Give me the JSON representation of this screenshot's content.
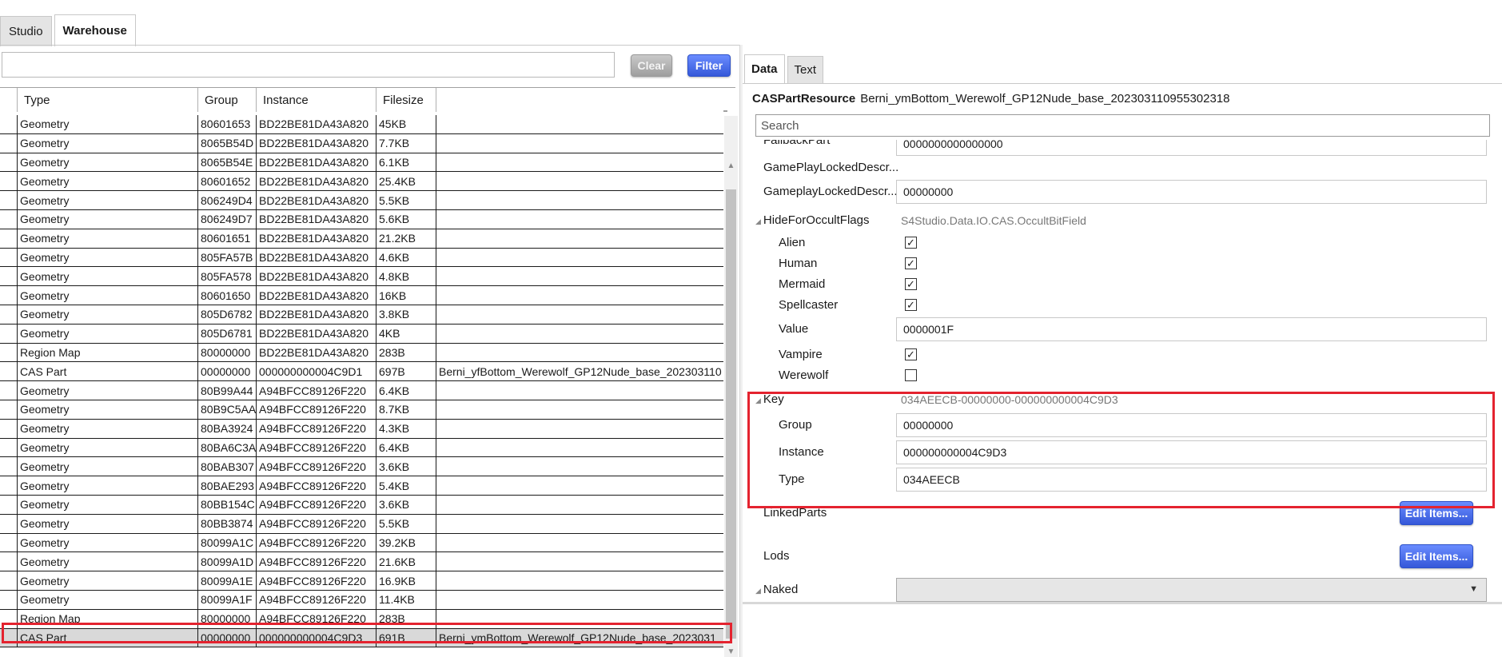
{
  "top_tabs": [
    {
      "label": "Studio",
      "active": false
    },
    {
      "label": "Warehouse",
      "active": true
    }
  ],
  "filter": {
    "value": "",
    "clear_label": "Clear",
    "filter_label": "Filter"
  },
  "grid": {
    "columns": [
      "",
      "Type",
      "Group",
      "Instance",
      "Filesize",
      ""
    ],
    "rows": [
      {
        "type": "Geometry",
        "group": "80601653",
        "instance": "BD22BE81DA43A820",
        "filesize": "45KB",
        "name": ""
      },
      {
        "type": "Geometry",
        "group": "8065B54D",
        "instance": "BD22BE81DA43A820",
        "filesize": "7.7KB",
        "name": ""
      },
      {
        "type": "Geometry",
        "group": "8065B54E",
        "instance": "BD22BE81DA43A820",
        "filesize": "6.1KB",
        "name": ""
      },
      {
        "type": "Geometry",
        "group": "80601652",
        "instance": "BD22BE81DA43A820",
        "filesize": "25.4KB",
        "name": ""
      },
      {
        "type": "Geometry",
        "group": "806249D4",
        "instance": "BD22BE81DA43A820",
        "filesize": "5.5KB",
        "name": ""
      },
      {
        "type": "Geometry",
        "group": "806249D7",
        "instance": "BD22BE81DA43A820",
        "filesize": "5.6KB",
        "name": ""
      },
      {
        "type": "Geometry",
        "group": "80601651",
        "instance": "BD22BE81DA43A820",
        "filesize": "21.2KB",
        "name": ""
      },
      {
        "type": "Geometry",
        "group": "805FA57B",
        "instance": "BD22BE81DA43A820",
        "filesize": "4.6KB",
        "name": ""
      },
      {
        "type": "Geometry",
        "group": "805FA578",
        "instance": "BD22BE81DA43A820",
        "filesize": "4.8KB",
        "name": ""
      },
      {
        "type": "Geometry",
        "group": "80601650",
        "instance": "BD22BE81DA43A820",
        "filesize": "16KB",
        "name": ""
      },
      {
        "type": "Geometry",
        "group": "805D6782",
        "instance": "BD22BE81DA43A820",
        "filesize": "3.8KB",
        "name": ""
      },
      {
        "type": "Geometry",
        "group": "805D6781",
        "instance": "BD22BE81DA43A820",
        "filesize": "4KB",
        "name": ""
      },
      {
        "type": "Region Map",
        "group": "80000000",
        "instance": "BD22BE81DA43A820",
        "filesize": "283B",
        "name": ""
      },
      {
        "type": "CAS Part",
        "group": "00000000",
        "instance": "000000000004C9D1",
        "filesize": "697B",
        "name": "Berni_yfBottom_Werewolf_GP12Nude_base_202303110"
      },
      {
        "type": "Geometry",
        "group": "80B99A44",
        "instance": "A94BFCC89126F220",
        "filesize": "6.4KB",
        "name": ""
      },
      {
        "type": "Geometry",
        "group": "80B9C5AA",
        "instance": "A94BFCC89126F220",
        "filesize": "8.7KB",
        "name": ""
      },
      {
        "type": "Geometry",
        "group": "80BA3924",
        "instance": "A94BFCC89126F220",
        "filesize": "4.3KB",
        "name": ""
      },
      {
        "type": "Geometry",
        "group": "80BA6C3A",
        "instance": "A94BFCC89126F220",
        "filesize": "6.4KB",
        "name": ""
      },
      {
        "type": "Geometry",
        "group": "80BAB307",
        "instance": "A94BFCC89126F220",
        "filesize": "3.6KB",
        "name": ""
      },
      {
        "type": "Geometry",
        "group": "80BAE293",
        "instance": "A94BFCC89126F220",
        "filesize": "5.4KB",
        "name": ""
      },
      {
        "type": "Geometry",
        "group": "80BB154C",
        "instance": "A94BFCC89126F220",
        "filesize": "3.6KB",
        "name": ""
      },
      {
        "type": "Geometry",
        "group": "80BB3874",
        "instance": "A94BFCC89126F220",
        "filesize": "5.5KB",
        "name": ""
      },
      {
        "type": "Geometry",
        "group": "80099A1C",
        "instance": "A94BFCC89126F220",
        "filesize": "39.2KB",
        "name": ""
      },
      {
        "type": "Geometry",
        "group": "80099A1D",
        "instance": "A94BFCC89126F220",
        "filesize": "21.6KB",
        "name": ""
      },
      {
        "type": "Geometry",
        "group": "80099A1E",
        "instance": "A94BFCC89126F220",
        "filesize": "16.9KB",
        "name": ""
      },
      {
        "type": "Geometry",
        "group": "80099A1F",
        "instance": "A94BFCC89126F220",
        "filesize": "11.4KB",
        "name": ""
      },
      {
        "type": "Region Map",
        "group": "80000000",
        "instance": "A94BFCC89126F220",
        "filesize": "283B",
        "name": ""
      },
      {
        "type": "CAS Part",
        "group": "00000000",
        "instance": "000000000004C9D3",
        "filesize": "691B",
        "name": "Berni_ymBottom_Werewolf_GP12Nude_base_2023031",
        "selected": true
      }
    ]
  },
  "right_tabs": [
    {
      "label": "Data",
      "active": true
    },
    {
      "label": "Text",
      "active": false
    }
  ],
  "resource": {
    "type_label": "CASPartResource",
    "name": "Berni_ymBottom_Werewolf_GP12Nude_base_202303110955302318"
  },
  "search": {
    "placeholder": "Search"
  },
  "props": {
    "fallback_label": "FallbackPart",
    "fallback_value": "0000000000000000",
    "gameplay_locked_1": "GamePlayLockedDescr...",
    "gameplay_locked_2": "GameplayLockedDescr...",
    "gameplay_locked_2_value": "00000000",
    "hide_occult_label": "HideForOccultFlags",
    "hide_occult_value": "S4Studio.Data.IO.CAS.OccultBitField",
    "occult": [
      {
        "label": "Alien",
        "checked": true
      },
      {
        "label": "Human",
        "checked": true
      },
      {
        "label": "Mermaid",
        "checked": true
      },
      {
        "label": "Spellcaster",
        "checked": true
      }
    ],
    "value_label": "Value",
    "value_value": "0000001F",
    "vampire_label": "Vampire",
    "vampire_checked": true,
    "werewolf_label": "Werewolf",
    "werewolf_checked": false,
    "key_label": "Key",
    "key_value": "034AEECB-00000000-000000000004C9D3",
    "key_group_label": "Group",
    "key_group_value": "00000000",
    "key_instance_label": "Instance",
    "key_instance_value": "000000000004C9D3",
    "key_type_label": "Type",
    "key_type_value": "034AEECB",
    "linked_parts_label": "LinkedParts",
    "lods_label": "Lods",
    "edit_items_label": "Edit Items...",
    "naked_label": "Naked",
    "naked_value": ""
  },
  "colors": {
    "highlight": "#e4232f",
    "button_blue": "#3558d9"
  }
}
